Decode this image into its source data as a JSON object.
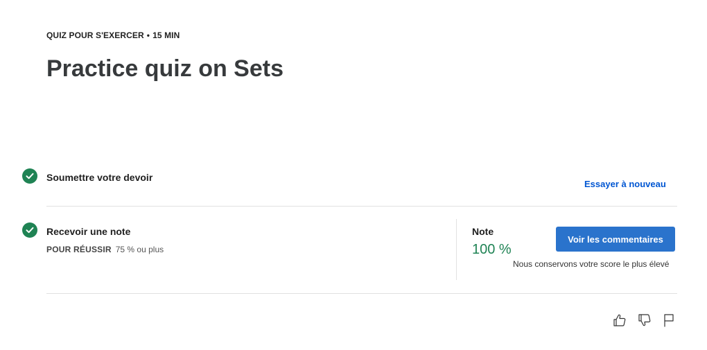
{
  "header": {
    "type_label": "QUIZ POUR S'EXERCER",
    "separator": "•",
    "duration": "15  MIN",
    "title": "Practice quiz on Sets"
  },
  "steps": {
    "submit": {
      "title": "Soumettre votre devoir",
      "retry_label": "Essayer à nouveau",
      "status_icon": "check-circle-icon"
    },
    "grade": {
      "title": "Recevoir une note",
      "pass_label": "POUR RÉUSSIR",
      "pass_value": "75 % ou plus",
      "status_icon": "check-circle-icon",
      "grade_label": "Note",
      "grade_value": "100 %",
      "feedback_button": "Voir les commentaires",
      "score_note": "Nous conservons votre score le plus élevé"
    }
  },
  "feedback_icons": [
    "thumbs-up-icon",
    "thumbs-down-icon",
    "flag-icon"
  ],
  "colors": {
    "success": "#1f8354",
    "link": "#0056d2",
    "primary_button": "#2a73cc"
  }
}
